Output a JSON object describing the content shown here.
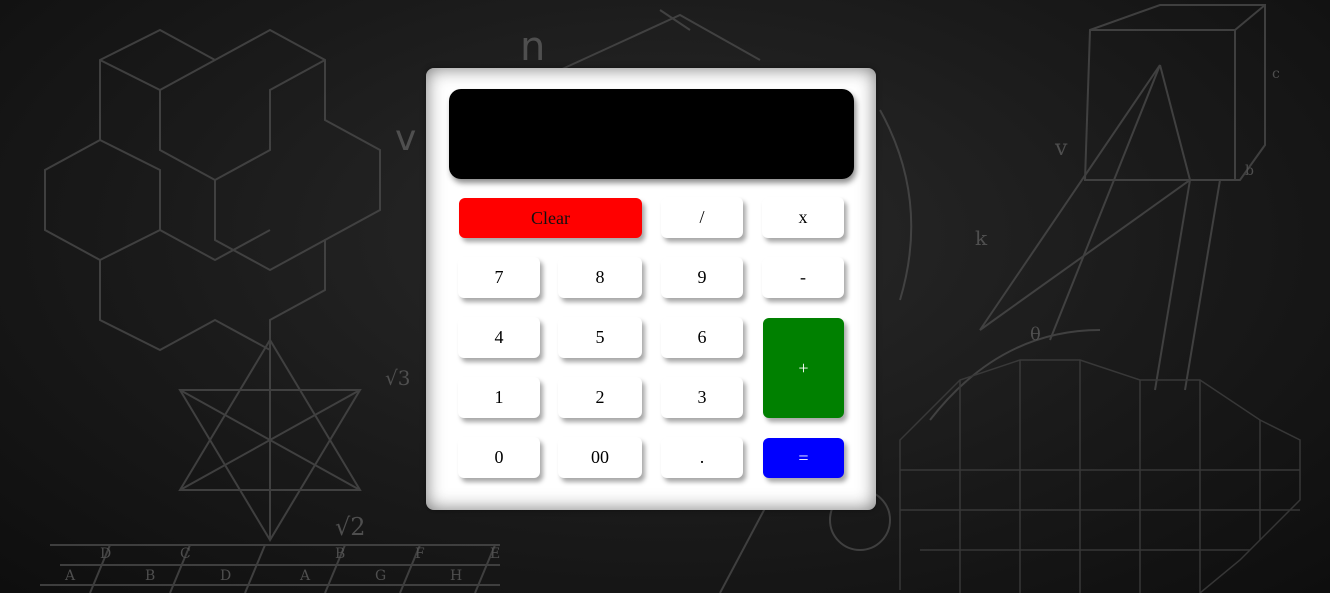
{
  "display": {
    "value": ""
  },
  "keys": {
    "clear": "Clear",
    "divide": "/",
    "multiply": "x",
    "seven": "7",
    "eight": "8",
    "nine": "9",
    "minus": "-",
    "four": "4",
    "five": "5",
    "six": "6",
    "plus": "+",
    "one": "1",
    "two": "2",
    "three": "3",
    "zero": "0",
    "double_zero": "00",
    "decimal": ".",
    "equals": "="
  },
  "colors": {
    "clear": "#ff0000",
    "plus": "#008000",
    "equals": "#0000ff",
    "display": "#000000"
  }
}
